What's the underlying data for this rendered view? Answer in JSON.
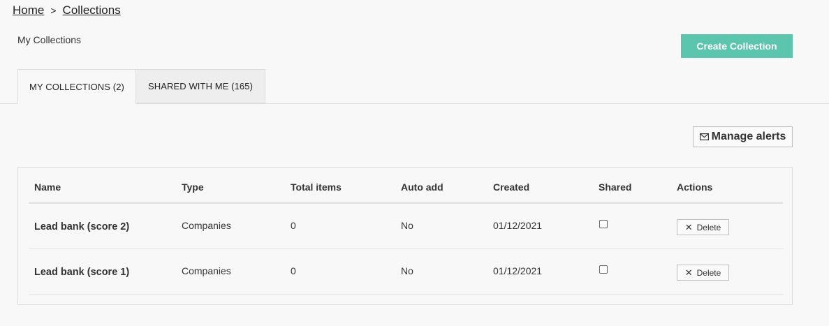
{
  "breadcrumb": {
    "home": "Home",
    "separator": ">",
    "current": "Collections"
  },
  "page": {
    "title": "My Collections",
    "create_label": "Create Collection",
    "accent": "#5bc6ad"
  },
  "tabs": [
    {
      "label": "MY COLLECTIONS (2)",
      "active": true
    },
    {
      "label": "SHARED WITH ME (165)",
      "active": false
    }
  ],
  "alerts": {
    "label": "Manage alerts",
    "icon": "envelope-icon"
  },
  "table": {
    "headers": [
      "Name",
      "Type",
      "Total items",
      "Auto add",
      "Created",
      "Shared",
      "Actions"
    ],
    "rows": [
      {
        "name": "Lead bank (score 2)",
        "type": "Companies",
        "total": "0",
        "auto_add": "No",
        "created": "01/12/2021",
        "shared": false,
        "action": "Delete"
      },
      {
        "name": "Lead bank (score 1)",
        "type": "Companies",
        "total": "0",
        "auto_add": "No",
        "created": "01/12/2021",
        "shared": false,
        "action": "Delete"
      }
    ]
  }
}
